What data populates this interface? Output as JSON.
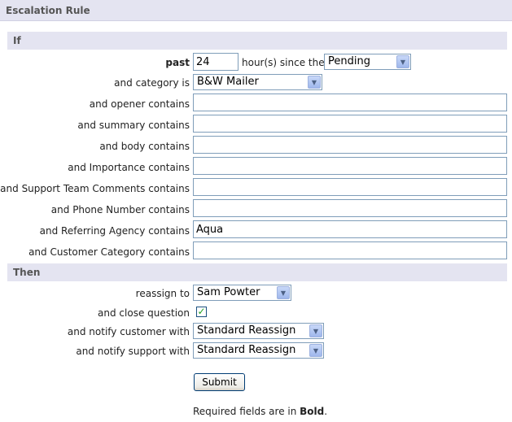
{
  "title": "Escalation Rule",
  "if_section": {
    "heading": "If",
    "past_label": "past",
    "hours_value": "24",
    "since_label": "hour(s) since the",
    "status_selected": "Pending",
    "category_label": "and category is",
    "category_selected": "B&W Mailer",
    "fields": [
      {
        "label": "and opener contains",
        "value": ""
      },
      {
        "label": "and summary contains",
        "value": ""
      },
      {
        "label": "and body contains",
        "value": ""
      },
      {
        "label": "and Importance contains",
        "value": ""
      },
      {
        "label": "and Support Team Comments contains",
        "value": ""
      },
      {
        "label": "and Phone Number contains",
        "value": ""
      },
      {
        "label": "and Referring Agency contains",
        "value": "Aqua"
      },
      {
        "label": "and Customer Category contains",
        "value": ""
      }
    ]
  },
  "then_section": {
    "heading": "Then",
    "reassign_label": "reassign to",
    "reassign_selected": "Sam Powter",
    "close_label": "and close question",
    "close_checked": true,
    "notify_customer_label": "and notify customer with",
    "notify_customer_selected": "Standard Reassign",
    "notify_support_label": "and notify support with",
    "notify_support_selected": "Standard Reassign"
  },
  "submit_label": "Submit",
  "footnote": {
    "prefix": "Required fields are in ",
    "bold": "Bold",
    "suffix": "."
  },
  "icons": {
    "dropdown": "chevron-down-icon",
    "check": "checkmark-icon"
  }
}
